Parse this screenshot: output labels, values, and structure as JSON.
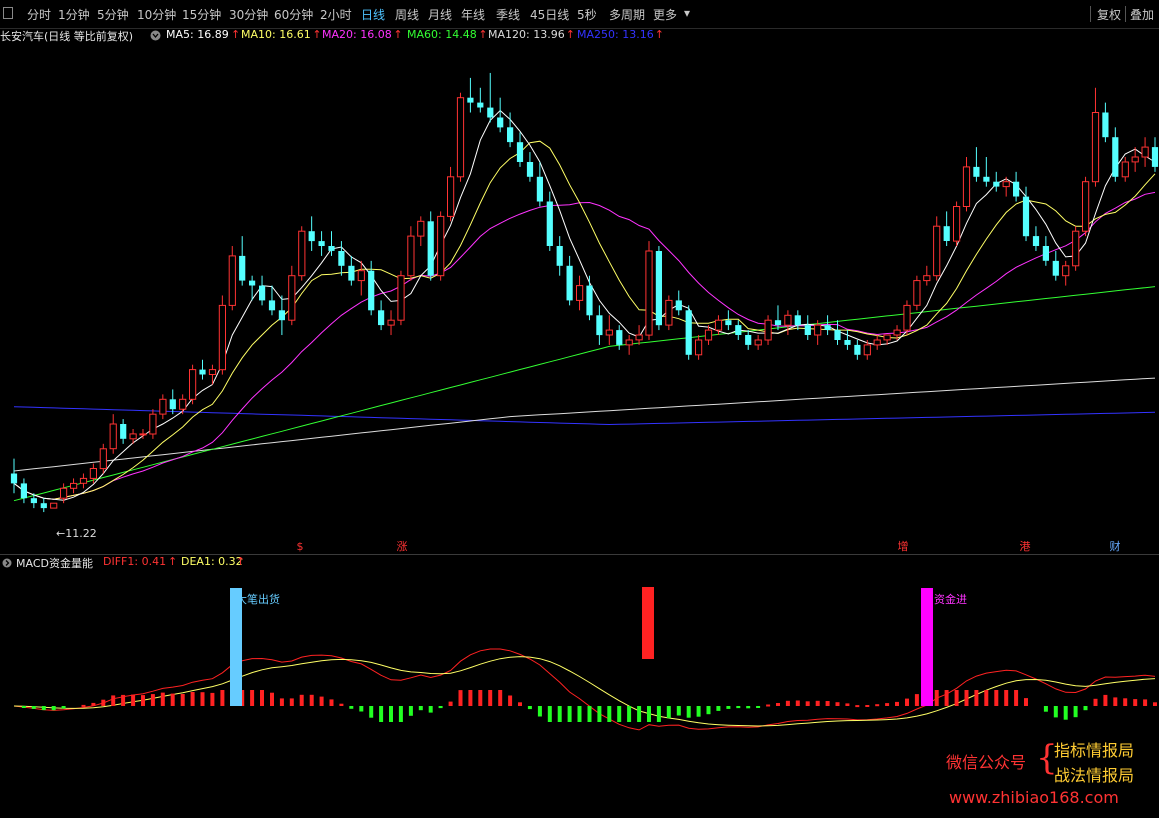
{
  "toolbar": {
    "periods": [
      "分时",
      "1分钟",
      "5分钟",
      "10分钟",
      "15分钟",
      "30分钟",
      "60分钟",
      "2小时",
      "日线",
      "周线",
      "月线",
      "年线",
      "季线",
      "45日线",
      "5秒",
      "多周期",
      "更多"
    ],
    "active": "日线",
    "more_arrow": "▾",
    "right": [
      "复权",
      "叠加"
    ]
  },
  "main": {
    "title": "长安汽车(日线 等比前复权)",
    "ma": [
      {
        "label": "MA5: 16.89",
        "color": "#ffffff"
      },
      {
        "label": "MA10: 16.61",
        "color": "#ffff66"
      },
      {
        "label": "MA20: 16.08",
        "color": "#ff33ff"
      },
      {
        "label": "MA60: 14.48",
        "color": "#33ff33"
      },
      {
        "label": "MA120: 13.96",
        "color": "#dcdcdc"
      },
      {
        "label": "MA250: 13.16",
        "color": "#3333ff"
      }
    ],
    "up_arrow": "↑",
    "low_label": "←11.22",
    "events": [
      {
        "text": "$",
        "x": 300,
        "color": "#ff3333"
      },
      {
        "text": "涨",
        "x": 402,
        "color": "#ff3333"
      },
      {
        "text": "增",
        "x": 903,
        "color": "#ff3333"
      },
      {
        "text": "港",
        "x": 1025,
        "color": "#ff3333"
      },
      {
        "text": "财",
        "x": 1115,
        "color": "#66aaff"
      }
    ]
  },
  "sub": {
    "title": "MACD资金量能",
    "diff": "DIFF1: 0.41",
    "dea": "DEA1: 0.32",
    "sell_label": "大笔出货",
    "buy_label": "资金进"
  },
  "watermark": {
    "account_label": "微信公众号",
    "brace": "{",
    "line1": "指标情报局",
    "line2": "战法情报局",
    "url": "www.zhibiao168.com"
  },
  "colors": {
    "up": "#ff3333",
    "down": "#55ffff",
    "ma5": "#ffffff",
    "ma10": "#ffff66",
    "ma20": "#ff33ff",
    "ma60": "#33ff33",
    "ma120": "#dcdcdc",
    "ma250": "#3333ff",
    "diff": "#ff2222",
    "dea": "#ffff66",
    "sell_bar": "#66ccff",
    "buy_bar": "#ff00ff",
    "macd_pos": "#ff2222",
    "macd_neg": "#22ff22"
  },
  "chart_data": [
    {
      "type": "candlestick",
      "series": [
        {
          "name": "MA5",
          "values": []
        },
        {
          "name": "MA10",
          "values": []
        },
        {
          "name": "MA20",
          "values": []
        },
        {
          "name": "MA60",
          "values": []
        },
        {
          "name": "MA120",
          "values": []
        },
        {
          "name": "MA250",
          "values": []
        }
      ],
      "ohlc": [
        [
          12.0,
          12.3,
          11.6,
          11.8
        ],
        [
          11.8,
          11.9,
          11.4,
          11.5
        ],
        [
          11.5,
          11.6,
          11.3,
          11.4
        ],
        [
          11.4,
          11.5,
          11.22,
          11.3
        ],
        [
          11.3,
          11.4,
          11.3,
          11.4
        ],
        [
          11.5,
          11.8,
          11.4,
          11.7
        ],
        [
          11.7,
          11.9,
          11.6,
          11.8
        ],
        [
          11.8,
          12.0,
          11.7,
          11.9
        ],
        [
          11.9,
          12.2,
          11.8,
          12.1
        ],
        [
          12.1,
          12.6,
          12.0,
          12.5
        ],
        [
          12.5,
          13.2,
          12.4,
          13.0
        ],
        [
          13.0,
          13.1,
          12.6,
          12.7
        ],
        [
          12.7,
          12.9,
          12.6,
          12.8
        ],
        [
          12.8,
          12.9,
          12.7,
          12.8
        ],
        [
          12.8,
          13.3,
          12.7,
          13.2
        ],
        [
          13.2,
          13.6,
          13.1,
          13.5
        ],
        [
          13.5,
          13.7,
          13.2,
          13.3
        ],
        [
          13.3,
          13.6,
          13.2,
          13.5
        ],
        [
          13.5,
          14.2,
          13.4,
          14.1
        ],
        [
          14.1,
          14.3,
          13.9,
          14.0
        ],
        [
          14.0,
          14.2,
          13.8,
          14.1
        ],
        [
          14.1,
          15.6,
          14.0,
          15.4
        ],
        [
          15.4,
          16.6,
          15.3,
          16.4
        ],
        [
          16.4,
          16.8,
          15.8,
          15.9
        ],
        [
          15.9,
          16.0,
          15.5,
          15.8
        ],
        [
          15.8,
          16.0,
          15.4,
          15.5
        ],
        [
          15.5,
          15.8,
          15.2,
          15.3
        ],
        [
          15.3,
          15.6,
          14.8,
          15.1
        ],
        [
          15.1,
          16.2,
          15.0,
          16.0
        ],
        [
          16.0,
          17.0,
          15.9,
          16.9
        ],
        [
          16.9,
          17.2,
          16.5,
          16.7
        ],
        [
          16.7,
          16.9,
          16.4,
          16.6
        ],
        [
          16.6,
          16.9,
          16.4,
          16.5
        ],
        [
          16.5,
          16.7,
          16.0,
          16.2
        ],
        [
          16.2,
          16.4,
          15.8,
          15.9
        ],
        [
          15.9,
          16.3,
          15.6,
          16.1
        ],
        [
          16.1,
          16.3,
          15.2,
          15.3
        ],
        [
          15.3,
          15.5,
          14.9,
          15.0
        ],
        [
          15.0,
          15.3,
          14.8,
          15.1
        ],
        [
          15.1,
          16.1,
          15.0,
          16.0
        ],
        [
          16.0,
          17.0,
          15.9,
          16.8
        ],
        [
          16.8,
          17.2,
          16.6,
          17.1
        ],
        [
          17.1,
          17.3,
          15.9,
          16.0
        ],
        [
          16.0,
          17.3,
          15.9,
          17.2
        ],
        [
          17.2,
          18.2,
          17.1,
          18.0
        ],
        [
          18.0,
          19.7,
          17.9,
          19.6
        ],
        [
          19.6,
          20.0,
          19.3,
          19.5
        ],
        [
          19.5,
          19.8,
          19.3,
          19.4
        ],
        [
          19.4,
          20.1,
          19.1,
          19.2
        ],
        [
          19.2,
          19.6,
          18.9,
          19.0
        ],
        [
          19.0,
          19.3,
          18.6,
          18.7
        ],
        [
          18.7,
          18.9,
          18.2,
          18.3
        ],
        [
          18.3,
          18.5,
          17.9,
          18.0
        ],
        [
          18.0,
          18.3,
          17.4,
          17.5
        ],
        [
          17.5,
          17.7,
          16.5,
          16.6
        ],
        [
          16.6,
          16.8,
          16.0,
          16.2
        ],
        [
          16.2,
          16.4,
          15.4,
          15.5
        ],
        [
          15.5,
          16.0,
          15.3,
          15.8
        ],
        [
          15.8,
          16.0,
          15.1,
          15.2
        ],
        [
          15.2,
          15.4,
          14.6,
          14.8
        ],
        [
          14.8,
          15.2,
          14.6,
          14.9
        ],
        [
          14.9,
          15.0,
          14.5,
          14.6
        ],
        [
          14.6,
          14.8,
          14.4,
          14.7
        ],
        [
          14.7,
          15.0,
          14.6,
          14.8
        ],
        [
          14.8,
          16.7,
          14.7,
          16.5
        ],
        [
          16.5,
          16.6,
          14.9,
          15.0
        ],
        [
          15.0,
          15.6,
          14.9,
          15.5
        ],
        [
          15.5,
          15.7,
          15.2,
          15.3
        ],
        [
          15.3,
          15.4,
          14.3,
          14.4
        ],
        [
          14.4,
          14.8,
          14.3,
          14.7
        ],
        [
          14.7,
          15.0,
          14.6,
          14.9
        ],
        [
          14.9,
          15.2,
          14.8,
          15.1
        ],
        [
          15.1,
          15.3,
          14.9,
          15.0
        ],
        [
          15.0,
          15.1,
          14.7,
          14.8
        ],
        [
          14.8,
          14.9,
          14.5,
          14.6
        ],
        [
          14.6,
          14.8,
          14.5,
          14.7
        ],
        [
          14.7,
          15.2,
          14.6,
          15.1
        ],
        [
          15.1,
          15.4,
          14.9,
          15.0
        ],
        [
          15.0,
          15.3,
          14.8,
          15.2
        ],
        [
          15.2,
          15.3,
          14.9,
          15.0
        ],
        [
          15.0,
          15.2,
          14.7,
          14.8
        ],
        [
          14.8,
          15.1,
          14.6,
          15.0
        ],
        [
          15.0,
          15.2,
          14.8,
          14.9
        ],
        [
          14.9,
          15.1,
          14.6,
          14.7
        ],
        [
          14.7,
          14.9,
          14.5,
          14.6
        ],
        [
          14.6,
          14.7,
          14.3,
          14.4
        ],
        [
          14.4,
          14.7,
          14.3,
          14.6
        ],
        [
          14.6,
          14.8,
          14.5,
          14.7
        ],
        [
          14.7,
          14.8,
          14.6,
          14.8
        ],
        [
          14.8,
          15.0,
          14.7,
          14.9
        ],
        [
          14.9,
          15.5,
          14.8,
          15.4
        ],
        [
          15.4,
          16.0,
          15.3,
          15.9
        ],
        [
          15.9,
          16.2,
          15.8,
          16.0
        ],
        [
          16.0,
          17.2,
          15.9,
          17.0
        ],
        [
          17.0,
          17.3,
          16.6,
          16.7
        ],
        [
          16.7,
          17.5,
          16.6,
          17.4
        ],
        [
          17.4,
          18.4,
          17.3,
          18.2
        ],
        [
          18.2,
          18.6,
          17.9,
          18.0
        ],
        [
          18.0,
          18.4,
          17.8,
          17.9
        ],
        [
          17.9,
          18.1,
          17.7,
          17.8
        ],
        [
          17.8,
          18.0,
          17.6,
          17.9
        ],
        [
          17.9,
          18.1,
          17.5,
          17.6
        ],
        [
          17.6,
          17.8,
          16.7,
          16.8
        ],
        [
          16.8,
          17.0,
          16.5,
          16.6
        ],
        [
          16.6,
          16.8,
          16.2,
          16.3
        ],
        [
          16.3,
          16.5,
          15.9,
          16.0
        ],
        [
          16.0,
          16.3,
          15.8,
          16.2
        ],
        [
          16.2,
          17.0,
          16.1,
          16.9
        ],
        [
          16.9,
          18.0,
          16.8,
          17.9
        ],
        [
          17.9,
          19.8,
          17.8,
          19.3
        ],
        [
          19.3,
          19.5,
          18.7,
          18.8
        ],
        [
          18.8,
          19.0,
          17.9,
          18.0
        ],
        [
          18.0,
          18.4,
          17.9,
          18.3
        ],
        [
          18.3,
          18.6,
          18.1,
          18.4
        ],
        [
          18.4,
          18.8,
          18.2,
          18.6
        ],
        [
          18.6,
          18.8,
          18.1,
          18.2
        ]
      ]
    }
  ]
}
